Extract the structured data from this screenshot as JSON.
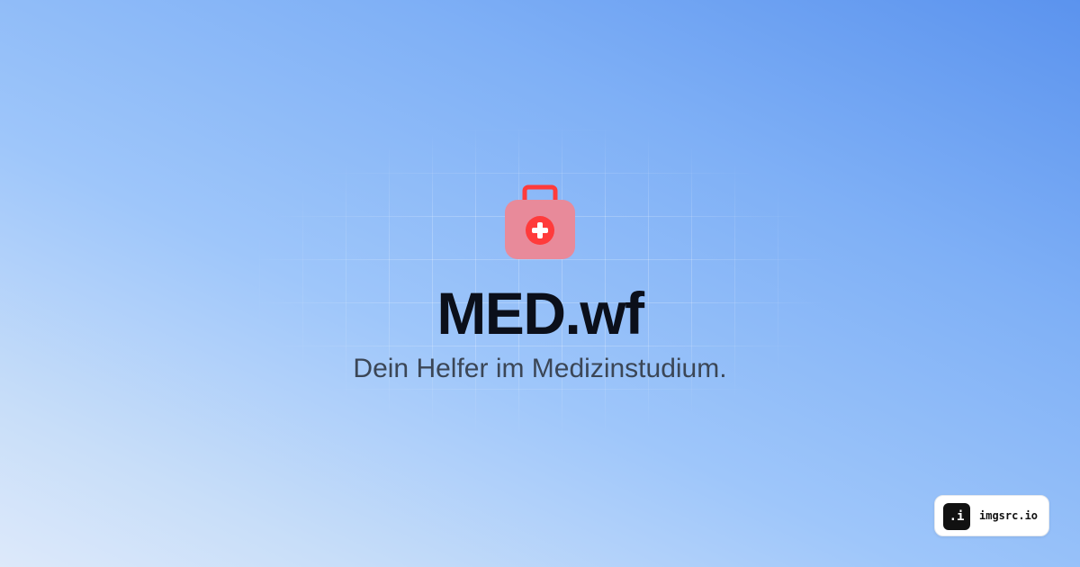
{
  "brand": {
    "icon": "medical-kit-icon",
    "title": "MED.wf",
    "tagline": "Dein Helfer im Medizinstudium.",
    "colors": {
      "icon_body": "#e88a9a",
      "icon_accent": "#ff3b3b"
    }
  },
  "watermark": {
    "mark": ".i",
    "label": "imgsrc.io"
  }
}
